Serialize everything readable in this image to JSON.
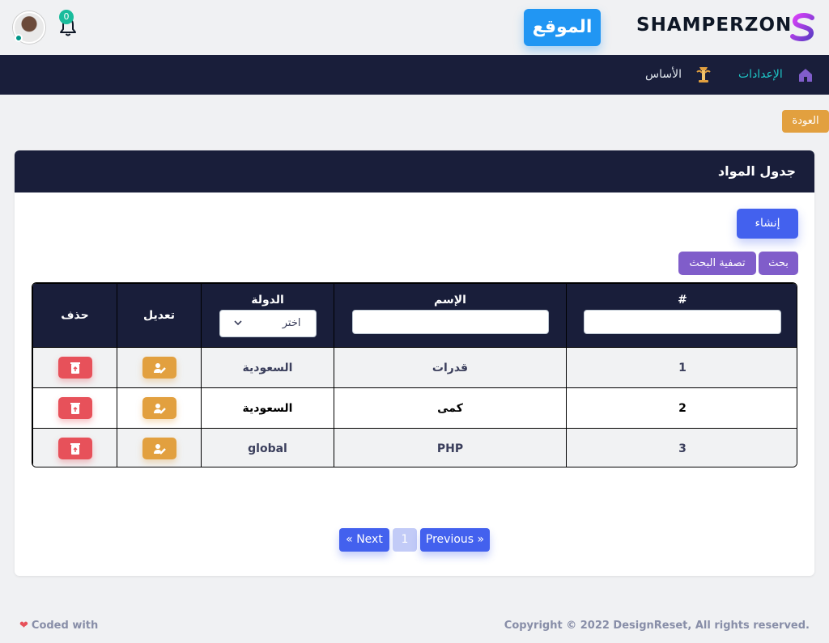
{
  "header": {
    "brand": "SHAMPERZON",
    "site_button": "الموقع",
    "notification_count": "0"
  },
  "nav": {
    "settings": "الإعدادات",
    "basic": "الأساس"
  },
  "back_button": "العودة",
  "card": {
    "title": "جدول المواد",
    "create_button": "إنشاء",
    "search_button": "بحث",
    "filter_button": "تصفية البحث"
  },
  "table": {
    "columns": {
      "number": "#",
      "name": "الإسم",
      "country": "الدولة",
      "edit": "تعديل",
      "delete": "حذف"
    },
    "country_select": "اختر",
    "rows": [
      {
        "id": "1",
        "name": "قدرات",
        "country": "السعودية"
      },
      {
        "id": "2",
        "name": "كمى",
        "country": "السعودية"
      },
      {
        "id": "3",
        "name": "PHP",
        "country": "global"
      }
    ]
  },
  "pagination": {
    "next": "« Next",
    "page": "1",
    "previous": "Previous »"
  },
  "footer": {
    "left": "Coded with",
    "right": "Copyright © 2022 DesignReset, All rights reserved."
  },
  "colors": {
    "primary": "#4361ee",
    "secondary": "#805dca",
    "warning": "#e2a03f",
    "danger": "#e7515a",
    "dark": "#191e3a",
    "info": "#2196f3"
  }
}
